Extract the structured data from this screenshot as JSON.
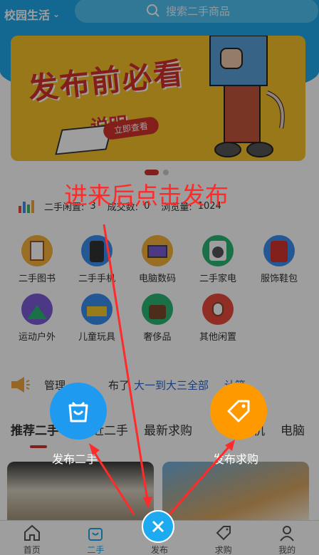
{
  "header": {
    "campus_label": "校园生活",
    "search_placeholder": "搜索二手商品"
  },
  "banner": {
    "title": "发布前必看",
    "subtitle": "说明",
    "button": "立即查看"
  },
  "stats": {
    "items": [
      {
        "label": "二手闲置:",
        "value": "3"
      },
      {
        "label": "成交数:",
        "value": "0"
      },
      {
        "label": "浏览量:",
        "value": "1024"
      }
    ]
  },
  "categories": [
    {
      "label": "二手图书",
      "icon": "book-icon"
    },
    {
      "label": "二手手机",
      "icon": "phone-icon"
    },
    {
      "label": "电脑数码",
      "icon": "laptop-icon"
    },
    {
      "label": "二手家电",
      "icon": "washer-icon"
    },
    {
      "label": "服饰鞋包",
      "icon": "clothes-icon"
    },
    {
      "label": "运动户外",
      "icon": "tent-icon"
    },
    {
      "label": "儿童玩具",
      "icon": "toy-icon"
    },
    {
      "label": "奢侈品",
      "icon": "handbag-icon"
    },
    {
      "label": "其他闲置",
      "icon": "watch-icon"
    }
  ],
  "notice": {
    "prefix": "管理",
    "middle": "布了",
    "highlight": "大一到大三全部",
    "suffix": "计算..."
  },
  "tabs": [
    "推荐二手",
    "近二手",
    "最新求购",
    "手机",
    "电脑"
  ],
  "tabbar": [
    {
      "label": "首页"
    },
    {
      "label": "二手"
    },
    {
      "label": "发布"
    },
    {
      "label": "求购"
    },
    {
      "label": "我的"
    }
  ],
  "overlay": {
    "annotation": "进来后点击发布",
    "publish_secondhand": "发布二手",
    "publish_request": "发布求购"
  },
  "colors": {
    "primary": "#1ea8e8",
    "accent": "#d2322a",
    "orange": "#ff9900",
    "annotation_red": "#ff2a2a"
  }
}
